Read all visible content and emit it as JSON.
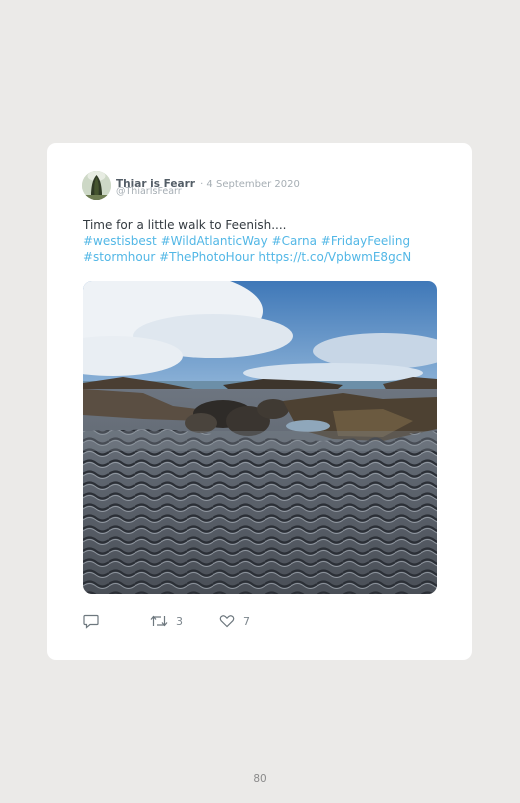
{
  "tweet": {
    "display_name": "Thiar is Fearr",
    "date": "· 4 September 2020",
    "handle": "@ThiarIsFearr",
    "text_plain": "Time for a little walk to Feenish....",
    "hashtags_line1": "#westisbest #WildAtlanticWay #Carna #FridayFeeling",
    "hashtags_line2": "#stormhour #ThePhotoHour https://t.co/VpbwmE8gcN",
    "replies_count": "",
    "retweets_count": "3",
    "likes_count": "7"
  },
  "icons": {
    "avatar": "avatar-icon",
    "reply": "reply-icon",
    "retweet": "retweet-icon",
    "like": "heart-icon"
  },
  "colors": {
    "page_background": "#ebeae8",
    "card_background": "#ffffff",
    "link": "#52b7e6",
    "name": "#545e67",
    "muted": "#a6aeb4"
  },
  "page": {
    "number": "80"
  }
}
